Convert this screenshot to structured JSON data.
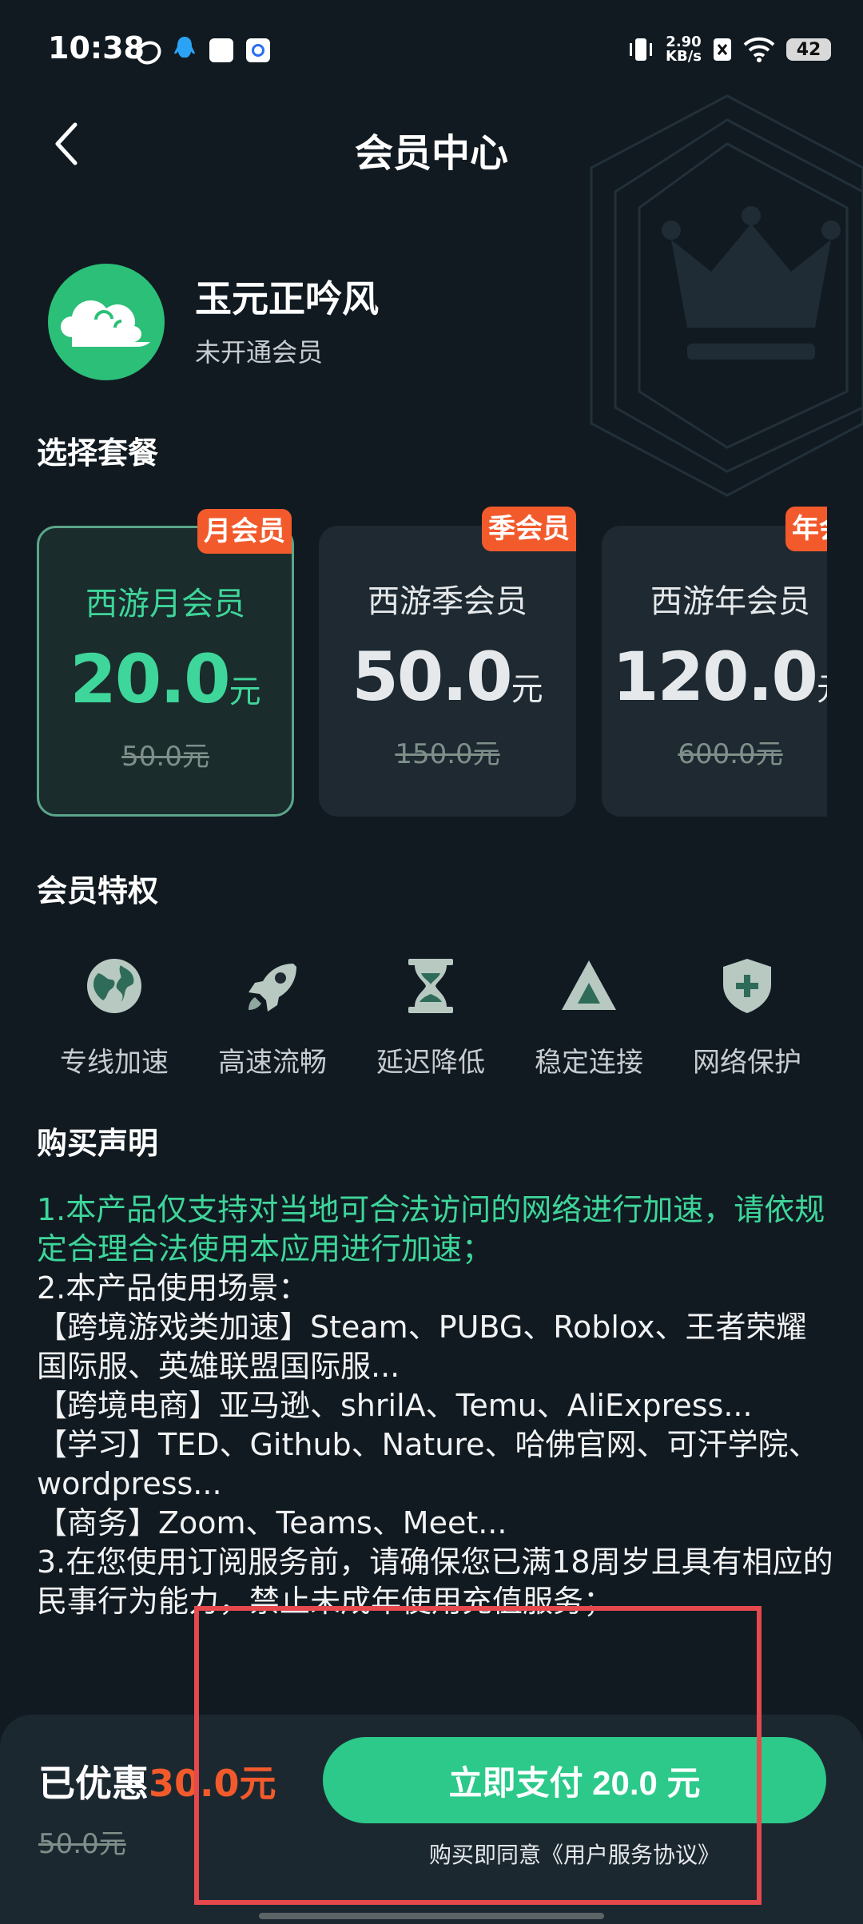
{
  "status_bar": {
    "time": "10:38",
    "net_speed_value": "2.90",
    "net_speed_unit": "KB/s",
    "battery": "42"
  },
  "header": {
    "title": "会员中心"
  },
  "profile": {
    "username": "玉元正吟风",
    "status": "未开通会员"
  },
  "plans_section": {
    "title": "选择套餐"
  },
  "plans": [
    {
      "badge": "月会员",
      "name": "西游月会员",
      "price": "20.0",
      "unit": "元",
      "original": "50.0元",
      "selected": true
    },
    {
      "badge": "季会员",
      "name": "西游季会员",
      "price": "50.0",
      "unit": "元",
      "original": "150.0元",
      "selected": false
    },
    {
      "badge": "年会员",
      "name": "西游年会员",
      "price": "120.0",
      "unit": "元",
      "original": "600.0元",
      "selected": false
    }
  ],
  "privileges_section": {
    "title": "会员特权"
  },
  "privileges": [
    {
      "label": "专线加速",
      "icon": "globe-icon"
    },
    {
      "label": "高速流畅",
      "icon": "rocket-icon"
    },
    {
      "label": "延迟降低",
      "icon": "hourglass-icon"
    },
    {
      "label": "稳定连接",
      "icon": "triangle-icon"
    },
    {
      "label": "网络保护",
      "icon": "shield-plus-icon"
    }
  ],
  "declaration": {
    "title": "购买声明",
    "lines": [
      "1.本产品仅支持对当地可合法访问的网络进行加速，请依规定合理合法使用本应用进行加速；",
      "2.本产品使用场景：",
      "【跨境游戏类加速】Steam、PUBG、Roblox、王者荣耀国际服、英雄联盟国际服...",
      "【跨境电商】亚马逊、shrilA、Temu、AliExpress...",
      "【学习】TED、Github、Nature、哈佛官网、可汗学院、wordpress...",
      "【商务】Zoom、Teams、Meet...",
      "3.在您使用订阅服务前，请确保您已满18周岁且具有相应的民事行为能力，禁止未成年使用充值服务；"
    ]
  },
  "bottom": {
    "saved_prefix": "已优惠",
    "saved_amount": "30.0元",
    "original_total": "50.0元",
    "pay_button": "立即支付 20.0 元",
    "agreement": "购买即同意《用户服务协议》"
  },
  "colors": {
    "accent_green": "#2cc98a",
    "badge_orange": "#f25a2c",
    "background": "#111a21",
    "highlight_red": "#e5484d"
  }
}
